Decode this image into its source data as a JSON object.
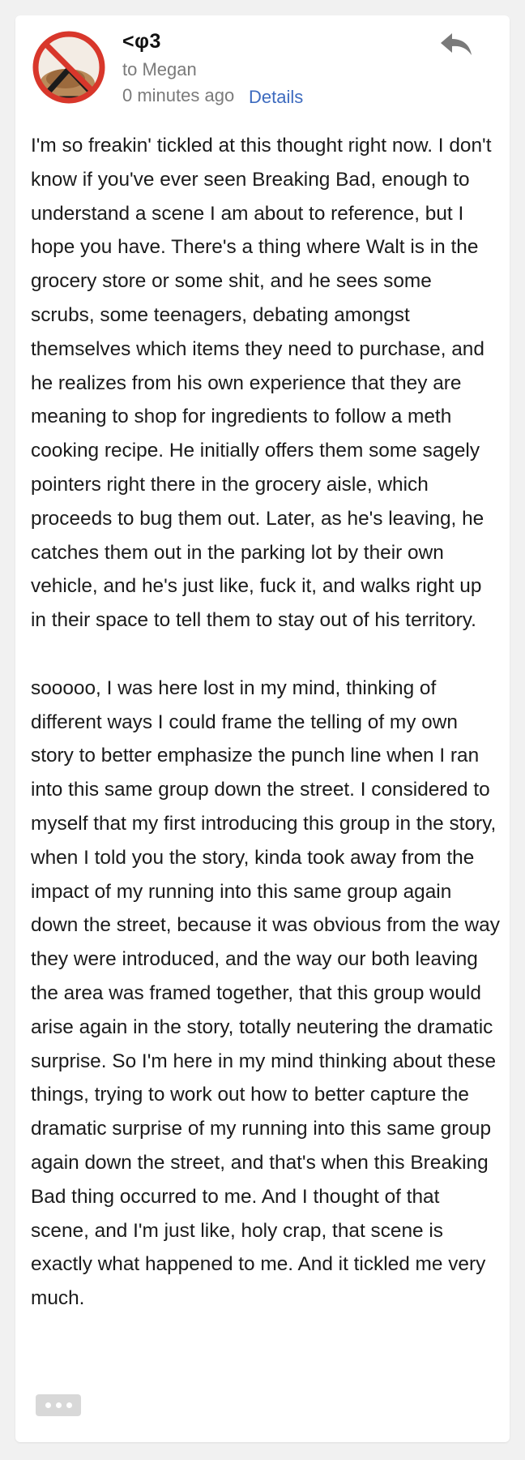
{
  "message": {
    "sender": "<φ3",
    "recipient": "to Megan",
    "timestamp": "0 minutes ago",
    "details_label": "Details",
    "paragraphs": [
      "I'm so freakin' tickled at this thought right now. I don't know if you've ever seen Breaking Bad, enough to understand a scene I am about to reference, but I hope you have. There's a thing where Walt is in the grocery store or some shit, and he sees some scrubs, some teenagers, debating amongst themselves which items they need to purchase, and he realizes from his own experience that they are meaning to shop for ingredients to follow a meth cooking recipe. He initially offers them some sagely pointers right there in the grocery aisle, which proceeds to bug them out. Later, as he's leaving, he catches them out in the parking lot by their own vehicle, and he's just like, fuck it, and walks right up in their space to tell them to stay out of his territory.",
      "sooooo, I was here lost in my mind, thinking of different ways I could frame the telling of my own story to better emphasize the punch line when I ran into this same group down the street. I considered to myself that my first introducing this group in the story, when I told you the story, kinda took away from the impact of my running into this same group again down the street, because it was obvious from the way they were introduced, and the way our both leaving the area was framed together, that this group would arise again in the story, totally neutering the dramatic surprise. So I'm here in my mind thinking about these things, trying to work out how to better capture the dramatic surprise of my running into this same group again down the street, and that's when this Breaking Bad thing occurred to me. And I thought of that scene, and I'm just like, holy crap, that scene is exactly what happened to me. And it tickled me very much."
    ]
  },
  "icons": {
    "avatar": "avatar-no-sign-image",
    "reply": "reply-arrow-icon",
    "more": "ellipsis-icon"
  },
  "colors": {
    "link": "#3d6bbf",
    "meta_text": "#7a7a7a",
    "body_text": "#1b1b1b",
    "background": "#f1f1f1",
    "card": "#ffffff",
    "more_button": "#d8d8d8",
    "avatar_red": "#d8372b"
  }
}
